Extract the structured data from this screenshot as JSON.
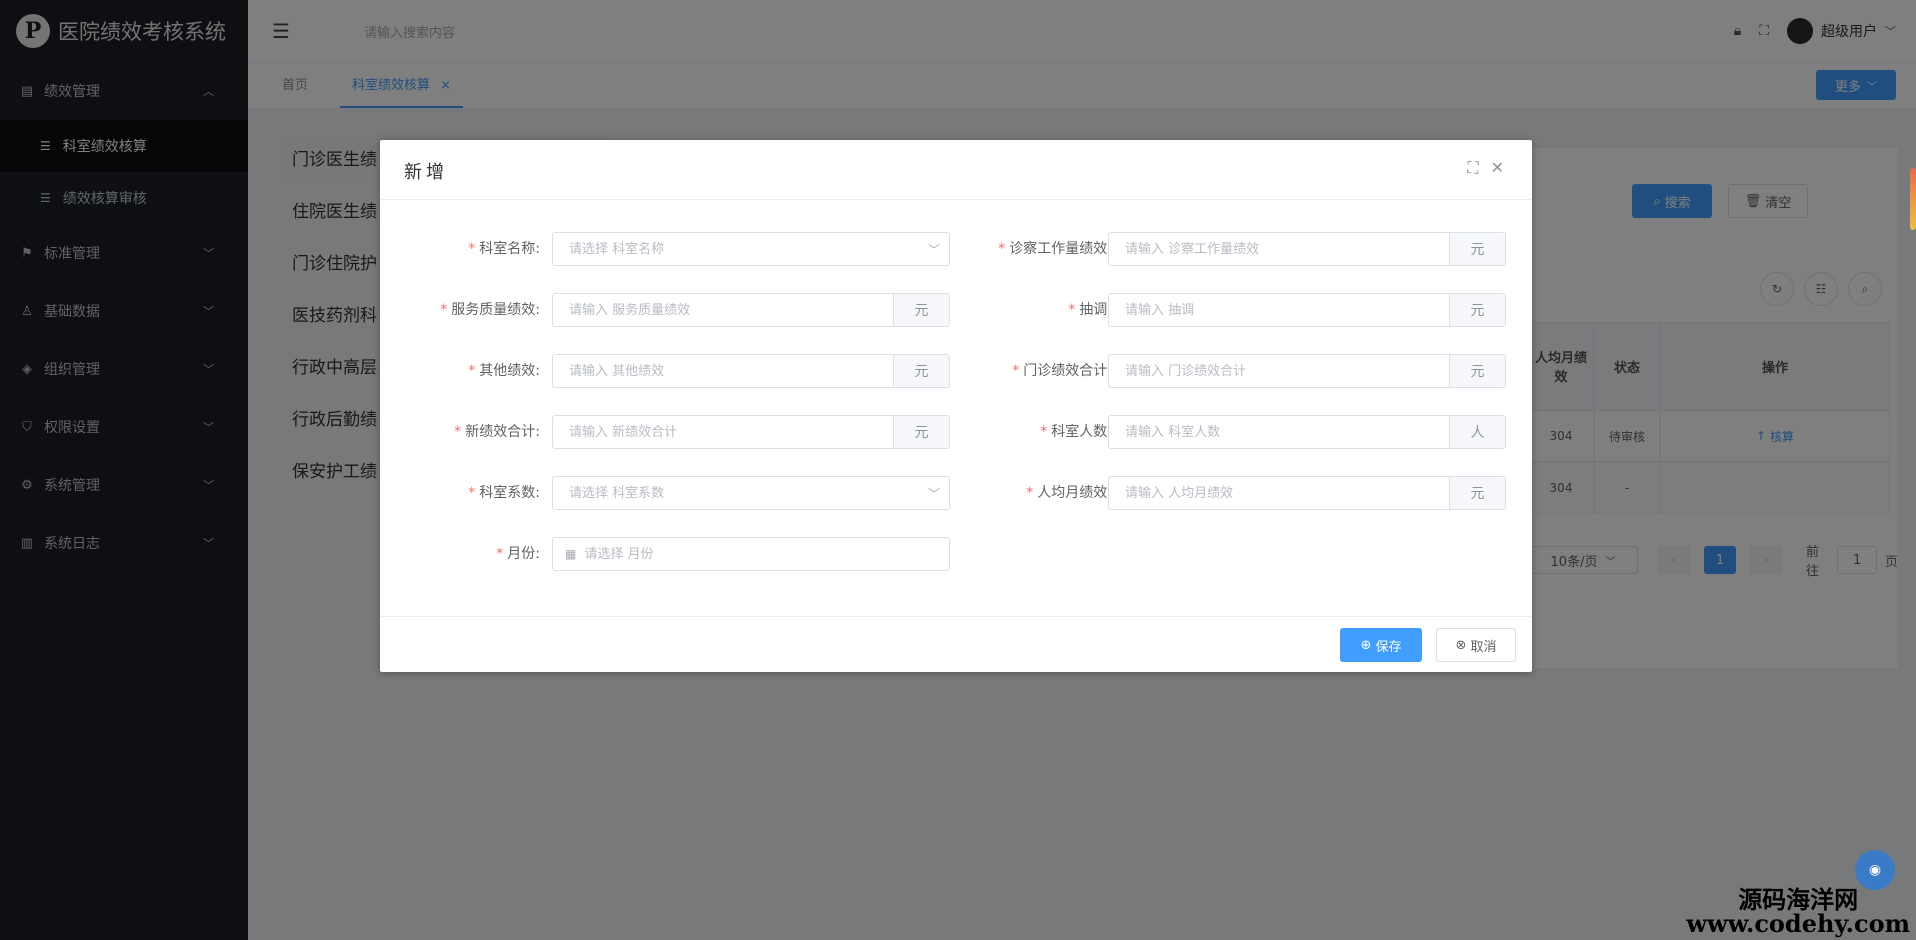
{
  "app": {
    "title": "医院绩效考核系统"
  },
  "sidebar": {
    "items": [
      {
        "label": "绩效管理",
        "icon": "doc-icon"
      },
      {
        "label": "科室绩效核算",
        "icon": "list-icon"
      },
      {
        "label": "绩效核算审核",
        "icon": "list-icon"
      },
      {
        "label": "标准管理",
        "icon": "flag-icon"
      },
      {
        "label": "基础数据",
        "icon": "user-icon"
      },
      {
        "label": "组织管理",
        "icon": "tag-icon"
      },
      {
        "label": "权限设置",
        "icon": "shield-icon"
      },
      {
        "label": "系统管理",
        "icon": "gear-icon"
      },
      {
        "label": "系统日志",
        "icon": "chart-icon"
      }
    ]
  },
  "header": {
    "search_placeholder": "请输入搜索内容",
    "user_name": "超级用户"
  },
  "tabs": {
    "home": "首页",
    "current": "科室绩效核算",
    "close": "×",
    "more": "更多"
  },
  "categories": [
    "门诊医生绩",
    "住院医生绩",
    "门诊住院护",
    "医技药剂科",
    "行政中高层",
    "行政后勤绩",
    "保安护工绩"
  ],
  "toolbar": {
    "search": "搜索",
    "clear": "清空"
  },
  "table": {
    "headers": {
      "avg": "人均月绩效",
      "status": "状态",
      "action": "操作"
    },
    "rows": [
      {
        "avg": "304",
        "status": "待审核",
        "action": "核算"
      },
      {
        "avg": "304",
        "status": "-",
        "action": ""
      }
    ]
  },
  "pagination": {
    "page_size": "10条/页",
    "current": "1",
    "goto_label": "前往",
    "goto_value": "1",
    "page_suffix": "页"
  },
  "dialog": {
    "title": "新增",
    "fields": {
      "dept_name": {
        "label": "科室名称:",
        "placeholder": "请选择 科室名称"
      },
      "diag_workload": {
        "label": "诊察工作量绩效:",
        "placeholder": "请输入 诊察工作量绩效",
        "unit": "元"
      },
      "service_quality": {
        "label": "服务质量绩效:",
        "placeholder": "请输入 服务质量绩效",
        "unit": "元"
      },
      "transfer": {
        "label": "抽调:",
        "placeholder": "请输入 抽调",
        "unit": "元"
      },
      "other": {
        "label": "其他绩效:",
        "placeholder": "请输入 其他绩效",
        "unit": "元"
      },
      "outpatient_total": {
        "label": "门诊绩效合计:",
        "placeholder": "请输入 门诊绩效合计",
        "unit": "元"
      },
      "new_total": {
        "label": "新绩效合计:",
        "placeholder": "请输入 新绩效合计",
        "unit": "元"
      },
      "dept_count": {
        "label": "科室人数:",
        "placeholder": "请输入 科室人数",
        "unit": "人"
      },
      "dept_coef": {
        "label": "科室系数:",
        "placeholder": "请选择 科室系数"
      },
      "avg_monthly": {
        "label": "人均月绩效:",
        "placeholder": "请输入 人均月绩效",
        "unit": "元"
      },
      "month": {
        "label": "月份:",
        "placeholder": "请选择 月份"
      }
    },
    "save": "保存",
    "cancel": "取消"
  },
  "watermark": {
    "line1": "源码海洋网",
    "line2": "www.codehy.com"
  }
}
